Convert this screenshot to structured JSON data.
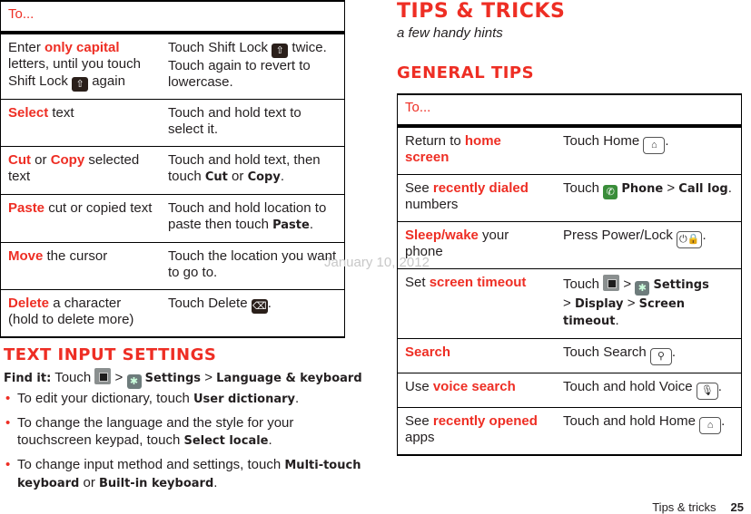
{
  "left_table": {
    "header": "To...",
    "rows": [
      {
        "pre": "Enter ",
        "hl": "only capital",
        "post": " letters, until you touch Shift Lock",
        "post2": " again",
        "action_pre": "Touch Shift Lock ",
        "action_post": " twice. Touch again to revert to lowercase.",
        "icon": "shift-lock-icon",
        "icon_glyph": "⇧"
      },
      {
        "hl": "Select",
        "post": " text",
        "action": "Touch and hold text to select it."
      },
      {
        "hl": "Cut",
        "mid": " or ",
        "hl2": "Copy",
        "post": " selected text",
        "action_pre": "Touch and hold text, then touch ",
        "b1": "Cut",
        "or": " or ",
        "b2": "Copy",
        "end": "."
      },
      {
        "hl": "Paste",
        "post": " cut or copied text",
        "action_pre": "Touch and hold location to paste then touch ",
        "b1": "Paste",
        "end": "."
      },
      {
        "hl": "Move",
        "post": " the cursor",
        "action": "Touch the location you want to go to."
      },
      {
        "hl": "Delete",
        "post": " a character (hold to delete more)",
        "action_pre": "Touch Delete ",
        "end": ".",
        "icon": "delete-icon",
        "icon_glyph": "⌫"
      }
    ]
  },
  "text_input_settings": {
    "heading": "TEXT INPUT SETTINGS",
    "find_it_label": "Find it:",
    "find_it_touch": " Touch ",
    "sep": " > ",
    "settings": "Settings",
    "lang": "Language & keyboard",
    "bullets": [
      {
        "pre": "To edit your dictionary, touch ",
        "b": "User dictionary",
        "post": "."
      },
      {
        "pre": "To change the language and the style for your touchscreen keypad, touch ",
        "b": "Select locale",
        "post": "."
      },
      {
        "pre": "To change input method and settings, touch ",
        "b": "Multi-touch keyboard",
        "mid": " or ",
        "b2": "Built-in keyboard",
        "post": "."
      }
    ]
  },
  "page": {
    "title": "TIPS & TRICKS",
    "subtitle": "a few handy hints",
    "section": "GENERAL TIPS",
    "watermark": "January 10, 2012",
    "footer_label": "Tips & tricks",
    "page_number": "25"
  },
  "right_table": {
    "header": "To...",
    "rows": [
      {
        "pre": "Return to ",
        "hl": "home screen",
        "action_pre": "Touch Home ",
        "end": "."
      },
      {
        "pre": "See ",
        "hl": "recently dialed",
        "post": " numbers",
        "action_pre": "Touch ",
        "b1": "Phone",
        "sep": " > ",
        "b2": "Call log",
        "end": "."
      },
      {
        "hl": "Sleep/wake",
        "post": " your phone",
        "action_pre": "Press Power/Lock ",
        "end": "."
      },
      {
        "pre": "Set ",
        "hl": "screen timeout",
        "action_pre": "Touch ",
        "sep": " > ",
        "b1": "Settings",
        "b2": "Display",
        "b3": "Screen timeout",
        "end": "."
      },
      {
        "hl": "Search",
        "action_pre": "Touch Search ",
        "end": "."
      },
      {
        "pre": "Use ",
        "hl": "voice search",
        "action_pre": "Touch and hold Voice ",
        "end": "."
      },
      {
        "pre": "See ",
        "hl": "recently opened",
        "post": " apps",
        "action_pre": "Touch and hold Home ",
        "end": "."
      }
    ]
  }
}
